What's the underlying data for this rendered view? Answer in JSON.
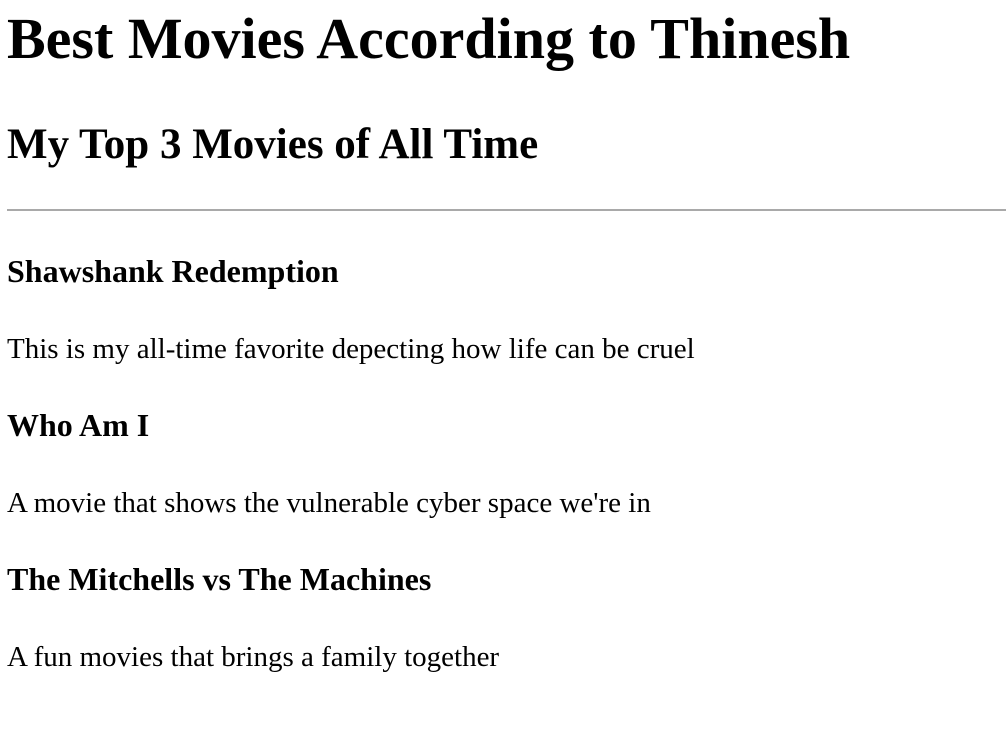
{
  "page": {
    "title": "Best Movies According to Thinesh",
    "subtitle": "My Top 3 Movies of All Time"
  },
  "movies": [
    {
      "title": "Shawshank Redemption",
      "description": "This is my all-time favorite depecting how life can be cruel"
    },
    {
      "title": "Who Am I",
      "description": "A movie that shows the vulnerable cyber space we're in"
    },
    {
      "title": "The Mitchells vs The Machines",
      "description": "A fun movies that brings a family together"
    }
  ]
}
